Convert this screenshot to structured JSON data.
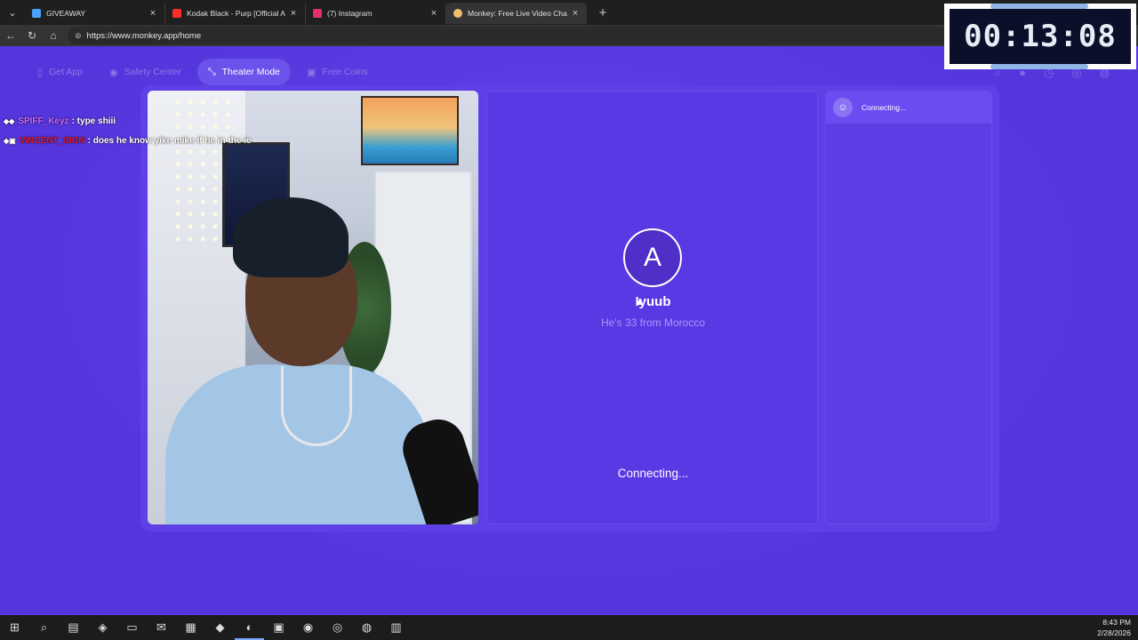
{
  "browser": {
    "tabs": [
      {
        "title": "GIVEAWAY",
        "fav_color": "#4aa3ff"
      },
      {
        "title": "Kodak Black - Purp [Official Audio]",
        "fav_color": "#ff2b2b"
      },
      {
        "title": "(7) Instagram",
        "fav_color": "#e1306c"
      },
      {
        "title": "Monkey: Free Live Video Chat",
        "fav_color": "#f0c070"
      }
    ],
    "url": "https://www.monkey.app/home"
  },
  "nav": {
    "get_app": "Get App",
    "safety_center": "Safety Center",
    "theater_mode": "Theater Mode",
    "free_coins": "Free Coins"
  },
  "chat": {
    "line1_user": "SPIFF_Keyz",
    "line1_msg": ": type shiii",
    "line2_user": "VINCENT_SIGN",
    "line2_msg": ": does he know yike mike if he in the ie"
  },
  "partner": {
    "initial": "A",
    "name": "Iyuub",
    "info": "He's 33 from Morocco",
    "status": "Connecting..."
  },
  "side_panel": {
    "status": "Connecting..."
  },
  "timer": {
    "value": "00:13:08"
  },
  "taskbar": {
    "time": "8:43 PM",
    "date": "2/28/2026"
  }
}
